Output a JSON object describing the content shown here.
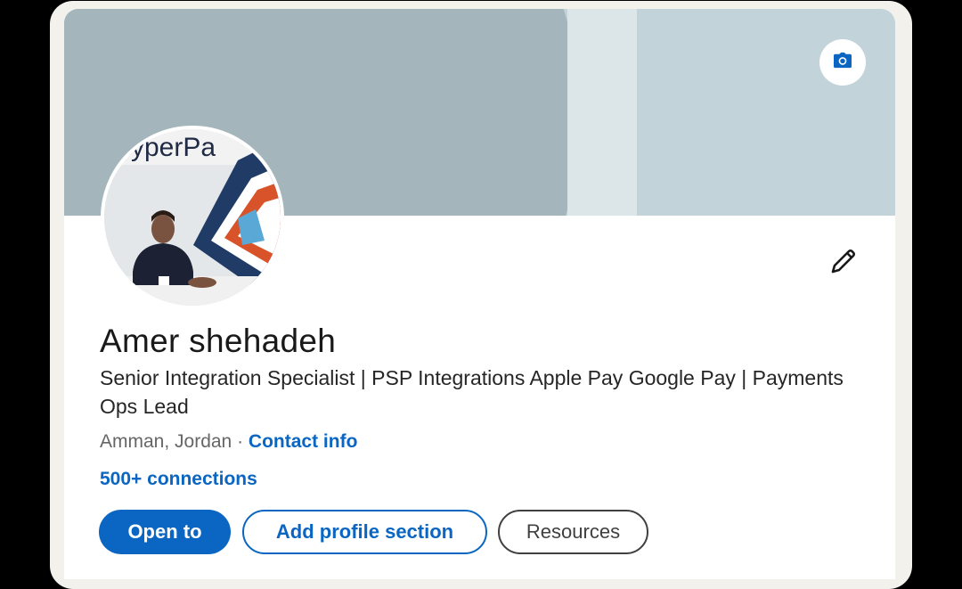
{
  "profile": {
    "name": "Amer shehadeh",
    "headline": "Senior Integration Specialist | PSP Integrations Apple Pay Google Pay | Payments Ops Lead",
    "location": "Amman, Jordan",
    "separator": "·",
    "contact_info_label": "Contact info",
    "connections_label": "500+ connections",
    "avatar_logo_text": "yperPa"
  },
  "actions": {
    "open_to_label": "Open to",
    "add_section_label": "Add profile section",
    "resources_label": "Resources"
  },
  "icons": {
    "camera": "camera-icon",
    "edit": "pencil-icon"
  },
  "colors": {
    "accent": "#0a66c2",
    "banner": "#c3d3da",
    "banner_circle": "#a4b6bc"
  }
}
